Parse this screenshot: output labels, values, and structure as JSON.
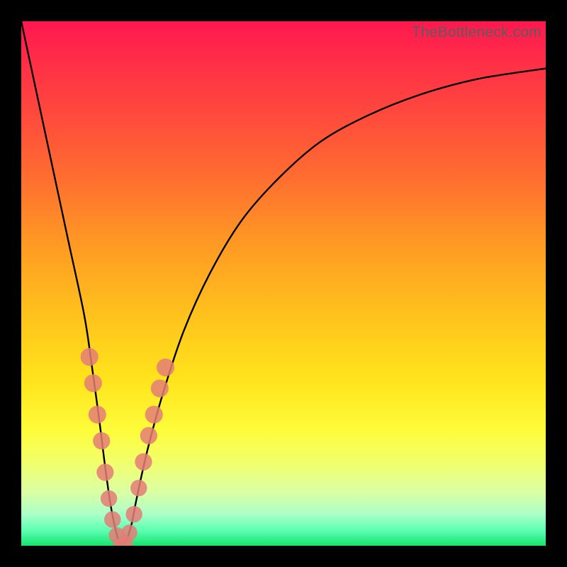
{
  "attribution": "TheBottleneck.com",
  "colors": {
    "frame": "#000000",
    "curve": "#000000",
    "bead": "#e47d77",
    "gradient_top": "#ff184f",
    "gradient_bottom": "#15e36e"
  },
  "chart_data": {
    "type": "line",
    "title": "",
    "xlabel": "",
    "ylabel": "",
    "xlim": [
      0,
      100
    ],
    "ylim": [
      0,
      100
    ],
    "grid": false,
    "series": [
      {
        "name": "bottleneck-curve",
        "x": [
          0,
          3,
          6,
          9,
          12,
          13.5,
          15,
          16,
          17,
          18,
          19,
          20,
          21,
          22,
          24,
          27,
          31,
          36,
          42,
          49,
          57,
          66,
          76,
          87,
          100
        ],
        "values": [
          100,
          86,
          72,
          58,
          44,
          34,
          23,
          15,
          8,
          3,
          0,
          1,
          4,
          9,
          18,
          29,
          41,
          52,
          62,
          70,
          77,
          82,
          86,
          89,
          91
        ]
      }
    ],
    "markers": {
      "name": "region-of-interest-beads",
      "points": [
        {
          "x": 13.0,
          "y": 36,
          "r": 2.1
        },
        {
          "x": 13.7,
          "y": 31,
          "r": 2.1
        },
        {
          "x": 14.5,
          "y": 25,
          "r": 2.1
        },
        {
          "x": 15.3,
          "y": 20,
          "r": 2.0
        },
        {
          "x": 16.0,
          "y": 14,
          "r": 2.0
        },
        {
          "x": 16.7,
          "y": 9,
          "r": 1.9
        },
        {
          "x": 17.4,
          "y": 5,
          "r": 1.9
        },
        {
          "x": 18.2,
          "y": 2,
          "r": 1.8
        },
        {
          "x": 19.0,
          "y": 0,
          "r": 1.8
        },
        {
          "x": 19.8,
          "y": 0.5,
          "r": 1.8
        },
        {
          "x": 20.6,
          "y": 2.5,
          "r": 1.8
        },
        {
          "x": 21.5,
          "y": 6,
          "r": 1.9
        },
        {
          "x": 22.4,
          "y": 11,
          "r": 1.9
        },
        {
          "x": 23.3,
          "y": 16,
          "r": 2.0
        },
        {
          "x": 24.3,
          "y": 21,
          "r": 2.0
        },
        {
          "x": 25.3,
          "y": 25,
          "r": 2.1
        },
        {
          "x": 26.4,
          "y": 30,
          "r": 2.1
        },
        {
          "x": 27.5,
          "y": 34,
          "r": 2.1
        }
      ]
    }
  }
}
